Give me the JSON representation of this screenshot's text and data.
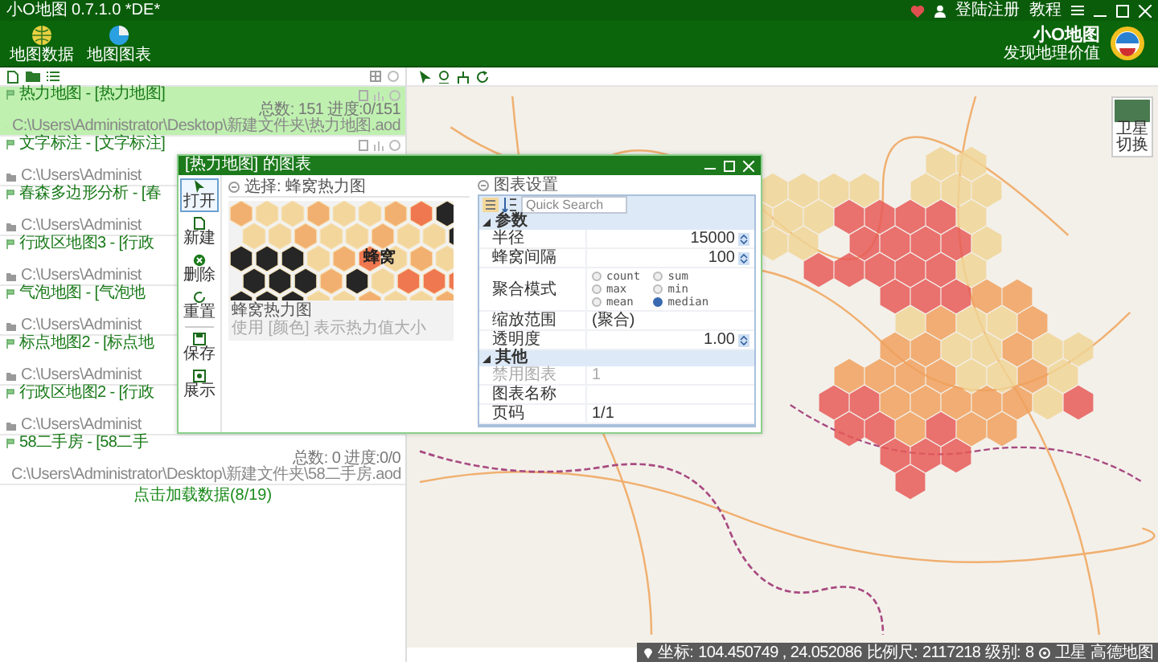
{
  "window": {
    "title": "小O地图 0.7.1.0 *DE*",
    "account": "登陆注册",
    "help": "教程"
  },
  "ribbon": {
    "buttons": [
      {
        "label": "地图数据",
        "kind": "globe"
      },
      {
        "label": "地图图表",
        "kind": "pie"
      }
    ],
    "logo_title": "小O地图",
    "logo_subtitle": "发现地理价值"
  },
  "projects": {
    "items": [
      {
        "title": "热力地图 - [热力地图]",
        "stats": "总数: 151 进度:0/151",
        "path": "C:\\Users\\Administrator\\Desktop\\新建文件夹\\热力地图.aod",
        "selected": true
      },
      {
        "title": "文字标注 - [文字标注]",
        "path": "C:\\Users\\Administ",
        "selected": false
      },
      {
        "title": "春森多边形分析 - [春",
        "path": "C:\\Users\\Administ",
        "selected": false
      },
      {
        "title": "行政区地图3 - [行政",
        "path": "C:\\Users\\Administ",
        "selected": false
      },
      {
        "title": "气泡地图 - [气泡地",
        "path": "C:\\Users\\Administ",
        "selected": false
      },
      {
        "title": "标点地图2 - [标点地",
        "path": "C:\\Users\\Administ",
        "selected": false
      },
      {
        "title": "行政区地图2 - [行政",
        "path": "C:\\Users\\Administ",
        "selected": false
      },
      {
        "title": "58二手房 - [58二手",
        "stats": "总数: 0 进度:0/0",
        "path": "C:\\Users\\Administrator\\Desktop\\新建文件夹\\58二手房.aod",
        "selected": false
      }
    ],
    "load_more": "点击加载数据(8/19)"
  },
  "map": {
    "basemap_label": "卫星",
    "basemap_action": "切换",
    "status": {
      "coord_label": "坐标:",
      "coords": "104.450749 , 24.052086",
      "scale_label": "比例尺:",
      "scale": "2117218",
      "level_label": "级别:",
      "level": "8",
      "satellite": "卫星",
      "provider": "高德地图"
    }
  },
  "chart_dialog": {
    "title": "[热力地图] 的图表",
    "sidebar": [
      {
        "label": "打开",
        "kind": "pointer",
        "selected": true
      },
      {
        "label": "新建",
        "kind": "new",
        "selected": false
      },
      {
        "label": "删除",
        "kind": "delete",
        "selected": false
      },
      {
        "label": "重置",
        "kind": "reset",
        "selected": false
      },
      {
        "label": "保存",
        "kind": "save",
        "selected": false
      },
      {
        "label": "展示",
        "kind": "show",
        "selected": false
      }
    ],
    "selection": "选择: 蜂窝热力图",
    "template": {
      "image_label": "蜂窝",
      "name": "蜂窝热力图",
      "description": "使用 [颜色] 表示热力值大小"
    },
    "settings_title": "图表设置",
    "search_placeholder": "Quick Search",
    "categories": [
      {
        "name": "参数",
        "expanded": true,
        "rows": [
          {
            "kind": "number",
            "label": "半径",
            "value": "15000",
            "disabled": false
          },
          {
            "kind": "number",
            "label": "蜂窝间隔",
            "value": "100",
            "disabled": false
          },
          {
            "kind": "radio",
            "label": "聚合模式",
            "disabled": false,
            "options": [
              {
                "label": "count",
                "selected": false
              },
              {
                "label": "sum",
                "selected": false
              },
              {
                "label": "max",
                "selected": false
              },
              {
                "label": "min",
                "selected": false
              },
              {
                "label": "mean",
                "selected": false
              },
              {
                "label": "median",
                "selected": true
              }
            ]
          },
          {
            "kind": "text",
            "label": "缩放范围",
            "value": "(聚合)",
            "disabled": false
          },
          {
            "kind": "number",
            "label": "透明度",
            "value": "1.00",
            "disabled": false
          }
        ]
      },
      {
        "name": "其他",
        "expanded": true,
        "rows": [
          {
            "kind": "text",
            "label": "禁用图表",
            "value": "1",
            "disabled": true
          },
          {
            "kind": "text",
            "label": "图表名称",
            "disabled": false
          },
          {
            "kind": "text",
            "label": "页码",
            "value": "1/1",
            "disabled": false
          }
        ]
      }
    ]
  }
}
